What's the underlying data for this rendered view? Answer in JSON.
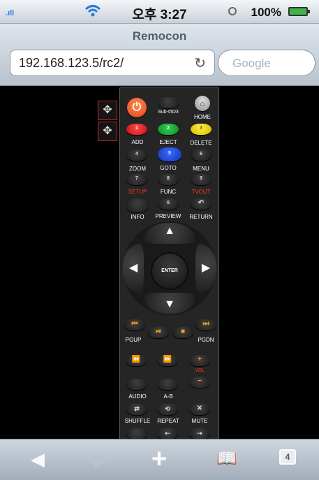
{
  "status_bar": {
    "carrier_signal": ".ıll",
    "time": "오후 3:27",
    "battery": "100%"
  },
  "browser": {
    "title": "Remocon",
    "url": "192.168.123.5/rc2/",
    "search_placeholder": "Google",
    "reload_icon": "↻"
  },
  "remote": {
    "power": "⏻",
    "subtitle": "Sub-t/ID3",
    "home_icon": "⌂",
    "home": "HOME",
    "btn1": "1",
    "btn2": "2",
    "btn3": "3",
    "btn4": "4",
    "btn5": "5",
    "btn6": "6",
    "btn7": "7",
    "btn8": "8",
    "btn9": "9",
    "btn0": "0",
    "add": "ADD",
    "eject": "EJECT",
    "delete": "DELETE",
    "zoom": "ZOOM",
    "goto": "GOTO",
    "menu": "MENU",
    "setup": "SETUP",
    "func": "FUNC",
    "tvout": "TVOUT",
    "info": "INFO",
    "preview": "PREVIEW",
    "return": "RETURN",
    "enter": "ENTER",
    "pgup": "PGUP",
    "pgdn": "PGDN",
    "vol": "VOL",
    "audio": "AUDIO",
    "ab": "A-B",
    "shuffle": "SHUFFLE",
    "repeat": "REPEAT",
    "mute": "MUTE"
  },
  "toolbar": {
    "tabs_count": "4"
  },
  "colors": {
    "accent_red": "#ff3b1a",
    "power": "#e2461a",
    "green": "#0f8a2a",
    "yellow": "#d6b800",
    "blue": "#1234b3"
  }
}
